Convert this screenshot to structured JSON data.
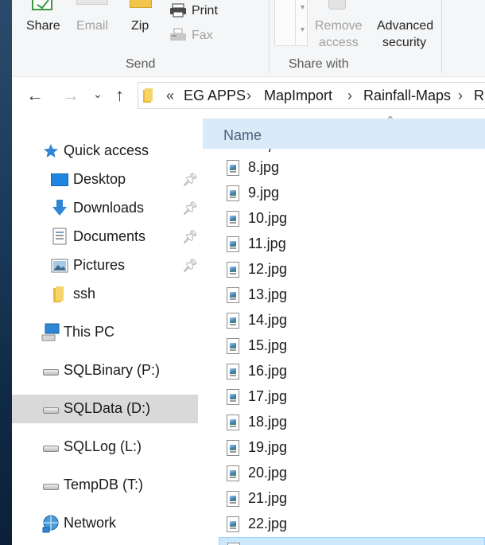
{
  "ribbon": {
    "share_label": "Share",
    "email_label": "Email",
    "zip_label": "Zip",
    "print_label": "Print",
    "fax_label": "Fax",
    "send_group": "Send",
    "remove_access_line1": "Remove",
    "remove_access_line2": "access",
    "advanced_security_line1": "Advanced",
    "advanced_security_line2": "security",
    "share_with_group": "Share with"
  },
  "address": {
    "overflow": "«",
    "crumbs": [
      "EG APPS",
      "MapImport",
      "Rainfall-Maps",
      "RI"
    ]
  },
  "navpane": {
    "quick_access": "Quick access",
    "items": [
      {
        "label": "Desktop",
        "pinned": true,
        "icon": "desktop-icon"
      },
      {
        "label": "Downloads",
        "pinned": true,
        "icon": "downloads-icon"
      },
      {
        "label": "Documents",
        "pinned": true,
        "icon": "documents-icon"
      },
      {
        "label": "Pictures",
        "pinned": true,
        "icon": "pictures-icon"
      },
      {
        "label": "ssh",
        "pinned": false,
        "icon": "folder-icon"
      }
    ],
    "this_pc": "This PC",
    "drives": [
      {
        "label": "SQLBinary (P:)",
        "selected": false
      },
      {
        "label": "SQLData (D:)",
        "selected": true
      },
      {
        "label": "SQLLog (L:)",
        "selected": false
      },
      {
        "label": "TempDB (T:)",
        "selected": false
      }
    ],
    "network": "Network"
  },
  "filelist": {
    "column_name": "Name",
    "files": [
      "8.jpg",
      "9.jpg",
      "10.jpg",
      "11.jpg",
      "12.jpg",
      "13.jpg",
      "14.jpg",
      "15.jpg",
      "16.jpg",
      "17.jpg",
      "18.jpg",
      "19.jpg",
      "20.jpg",
      "21.jpg",
      "22.jpg"
    ]
  },
  "colors": {
    "accent": "#d9ebf9",
    "selection": "#d9d9d9",
    "file_selection": "#cce8ff"
  }
}
